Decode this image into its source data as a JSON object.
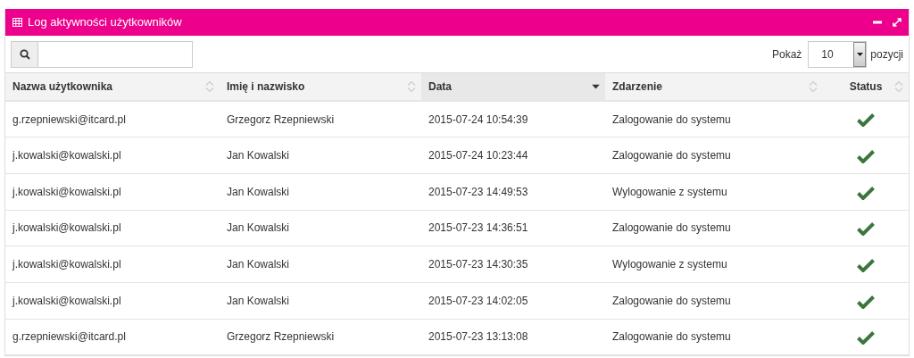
{
  "panel": {
    "title": "Log aktywności użytkowników"
  },
  "toolbar": {
    "show_label": "Pokaż",
    "page_size": "10",
    "suffix": "pozycji"
  },
  "table": {
    "columns": [
      {
        "label": "Nazwa użytkownika",
        "sorted": false
      },
      {
        "label": "Imię i nazwisko",
        "sorted": false
      },
      {
        "label": "Data",
        "sorted": true
      },
      {
        "label": "Zdarzenie",
        "sorted": false
      },
      {
        "label": "Status",
        "sorted": false
      }
    ],
    "rows": [
      {
        "user": "g.rzepniewski@itcard.pl",
        "name": "Grzegorz Rzepniewski",
        "date": "2015-07-24 10:54:39",
        "event": "Zalogowanie do systemu",
        "success": true
      },
      {
        "user": "j.kowalski@kowalski.pl",
        "name": "Jan Kowalski",
        "date": "2015-07-24 10:23:44",
        "event": "Zalogowanie do systemu",
        "success": true
      },
      {
        "user": "j.kowalski@kowalski.pl",
        "name": "Jan Kowalski",
        "date": "2015-07-23 14:49:53",
        "event": "Wylogowanie z systemu",
        "success": true
      },
      {
        "user": "j.kowalski@kowalski.pl",
        "name": "Jan Kowalski",
        "date": "2015-07-23 14:36:51",
        "event": "Zalogowanie do systemu",
        "success": true
      },
      {
        "user": "j.kowalski@kowalski.pl",
        "name": "Jan Kowalski",
        "date": "2015-07-23 14:30:35",
        "event": "Wylogowanie z systemu",
        "success": true
      },
      {
        "user": "j.kowalski@kowalski.pl",
        "name": "Jan Kowalski",
        "date": "2015-07-23 14:02:05",
        "event": "Zalogowanie do systemu",
        "success": true
      },
      {
        "user": "g.rzepniewski@itcard.pl",
        "name": "Grzegorz Rzepniewski",
        "date": "2015-07-23 13:13:08",
        "event": "Zalogowanie do systemu",
        "success": true
      }
    ]
  }
}
